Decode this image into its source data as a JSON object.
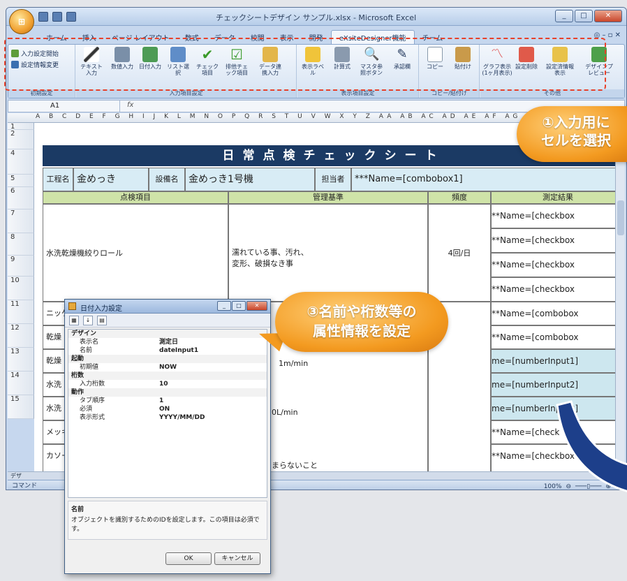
{
  "window": {
    "title": "チェックシートデザイン サンプル.xlsx - Microsoft Excel"
  },
  "ribbon_tabs": [
    "ホーム",
    "挿入",
    "ページ レイアウト",
    "数式",
    "データ",
    "校閲",
    "表示",
    "開発",
    "eXsiteDesigner機能",
    "チーム"
  ],
  "groups": {
    "init": {
      "label": "初期設定",
      "items": [
        "入力設定開始",
        "設定情報変更"
      ]
    },
    "input": {
      "label": "入力項目設定",
      "items": [
        "テキスト入力",
        "数値入力",
        "日付入力",
        "リスト選択",
        "チェック項目",
        "排他チェック項目",
        "データ連携入力"
      ]
    },
    "display": {
      "label": "表示項目設定",
      "items": [
        "表示ラベル",
        "計算式",
        "マスタ参照ボタン",
        "承認欄"
      ]
    },
    "copy": {
      "label": "コピー/貼付け",
      "items": [
        "コピー",
        "貼付け"
      ]
    },
    "other": {
      "label": "その他",
      "items": [
        "グラフ表示(1ヶ月表示)",
        "設定削除",
        "設定済情報表示",
        "デザインプレビュー"
      ]
    }
  },
  "namebox": "A1",
  "fx": "fx",
  "columns": "A B C D E F G H I J K L M N O P Q R S T U V W X Y Z AA AB AC AD AE AF AG AH AI AJ AK AL AM AN",
  "rows": [
    "1",
    "2",
    "3",
    "4",
    "5",
    "6",
    "7",
    "8",
    "9",
    "10",
    "11",
    "12",
    "13",
    "14",
    "15"
  ],
  "sheet": {
    "title": "日常点検チェックシート",
    "process_label": "工程名",
    "process_value": "金めっき",
    "equip_label": "設備名",
    "equip_value": "金めっき1号機",
    "person_label": "担当者",
    "person_value": "***Name=[combobox1]",
    "headers": [
      "点検項目",
      "管理基準",
      "頻度",
      "測定結果"
    ],
    "item1": "水洗乾燥機絞りロール",
    "criteria1": "濡れている事、汚れ、\n変形、破損なき事",
    "freq1": "4回/日",
    "items_left": [
      "ニッケ",
      "乾燥",
      "乾燥",
      "水洗",
      "水洗",
      "メッキ",
      "カソー"
    ],
    "criteria_more": [
      "1m/min",
      "0L/min",
      "まらないこと"
    ],
    "results": [
      "**Name=[checkbox",
      "**Name=[checkbox",
      "**Name=[checkbox",
      "**Name=[checkbox",
      "**Name=[combobox",
      "**Name=[combobox",
      "me=[numberInput1]",
      "me=[numberInput2]",
      "me=[numberInput3]",
      "**Name=[check",
      "**Name=[checkbox"
    ]
  },
  "sheettab": "デザ",
  "status": {
    "mode": "コマンド",
    "zoom": "100%"
  },
  "dialog": {
    "title": "日付入力設定",
    "cats": [
      "デザイン",
      "起動",
      "桁数",
      "動作"
    ],
    "props": [
      {
        "k": "表示名",
        "v": "測定日"
      },
      {
        "k": "名前",
        "v": "dateInput1"
      },
      {
        "k": "初期値",
        "v": "NOW"
      },
      {
        "k": "入力桁数",
        "v": "10"
      },
      {
        "k": "タブ順序",
        "v": "1"
      },
      {
        "k": "必須",
        "v": "ON"
      },
      {
        "k": "表示形式",
        "v": "YYYY/MM/DD"
      }
    ],
    "desc_title": "名前",
    "desc_text": "オブジェクトを識別するためのIDを設定します。この項目は必須です。",
    "ok": "OK",
    "cancel": "キャンセル"
  },
  "callouts": {
    "c1": "①入力用に\nセルを選択",
    "c3": "③名前や桁数等の\n属性情報を設定"
  }
}
